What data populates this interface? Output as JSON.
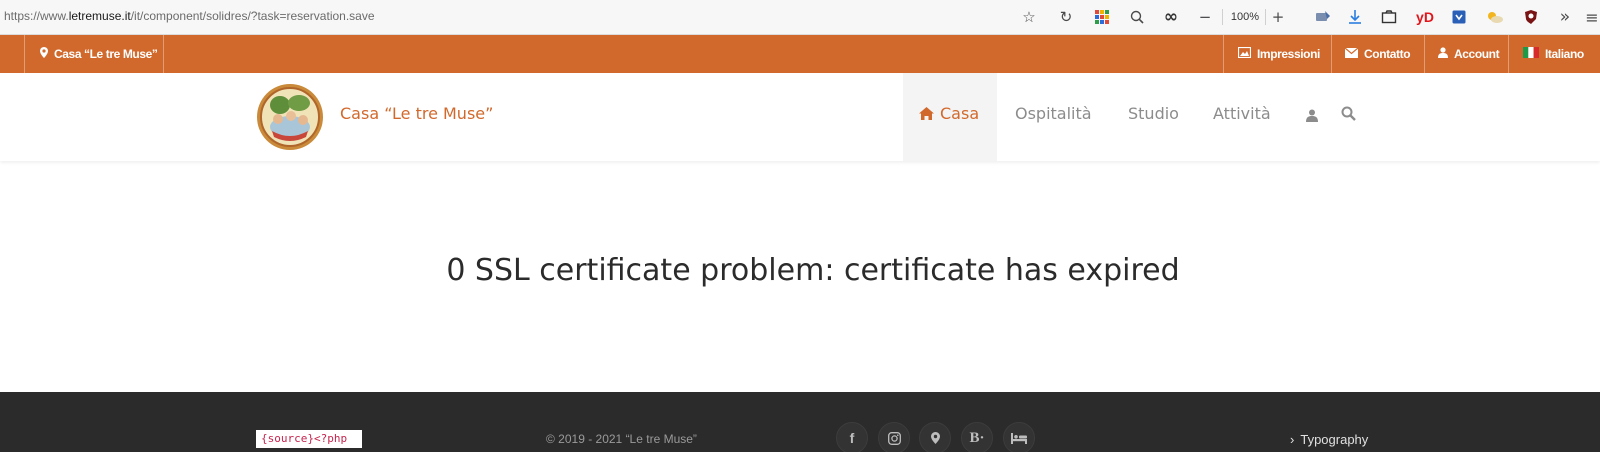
{
  "browser": {
    "url_prefix": "https://www.",
    "url_domain": "letremuse.it",
    "url_path": "/it/component/solidres/?task=reservation.save",
    "zoom": "100%",
    "icons": [
      "star-icon",
      "reload-icon",
      "apps-grid-icon",
      "search-icon",
      "infinity-icon",
      "zoom-out-icon",
      "zoom-in-icon",
      "extension-icon",
      "download-icon",
      "screenshot-icon",
      "yandex-icon",
      "save-icon",
      "weather-icon",
      "shield-icon",
      "overflow-icon",
      "menu-icon"
    ],
    "yd_label": "yD",
    "colors": {
      "chrome_bg": "#f7f7f8"
    }
  },
  "topbar": {
    "location": "Casa “Le tre Muse”",
    "impressions": "Impressioni",
    "contact": "Contatto",
    "account": "Account",
    "language": "Italiano",
    "colors": {
      "bg": "#d2692c"
    }
  },
  "header": {
    "site_name": "Casa “Le tre Muse”",
    "nav": [
      {
        "label": "Casa",
        "active": true
      },
      {
        "label": "Ospitalità",
        "active": false
      },
      {
        "label": "Studio",
        "active": false
      },
      {
        "label": "Attività",
        "active": false
      }
    ],
    "colors": {
      "accent": "#d2692c",
      "nav_text": "#8c8c8c"
    }
  },
  "main": {
    "message": "0 SSL certificate problem: certificate has expired"
  },
  "footer": {
    "source_code": "{source}<?php",
    "copyright": "© 2019 - 2021 “Le tre Muse”",
    "social_icons": [
      "facebook-icon",
      "instagram-icon",
      "map-marker-icon",
      "booking-icon",
      "bed-icon"
    ],
    "booking_label": "B·",
    "typography_link": "Typography",
    "colors": {
      "bg": "#2b2b2b"
    }
  }
}
